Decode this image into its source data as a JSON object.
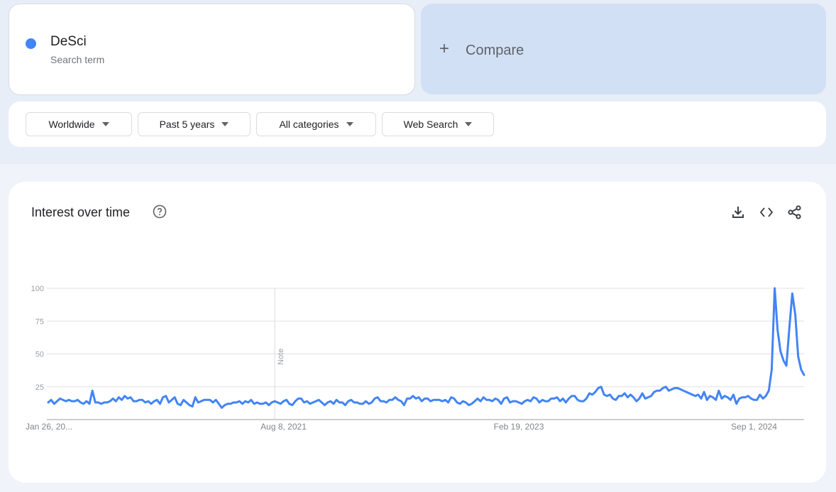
{
  "search_term": {
    "name": "DeSci",
    "subtitle": "Search term",
    "color": "#4285f4"
  },
  "compare": {
    "icon": "plus-icon",
    "label": "Compare"
  },
  "filters": [
    {
      "label": "Worldwide"
    },
    {
      "label": "Past 5 years"
    },
    {
      "label": "All categories"
    },
    {
      "label": "Web Search"
    }
  ],
  "interest_panel": {
    "title": "Interest over time",
    "icons": [
      "help-icon",
      "download-icon",
      "embed-code-icon",
      "share-icon"
    ]
  },
  "chart_data": {
    "type": "line",
    "title": "Interest over time",
    "xlabel": "",
    "ylabel": "",
    "ylim": [
      0,
      100
    ],
    "yticks": [
      25,
      50,
      75,
      100
    ],
    "x_tick_labels": [
      "Jan 26, 20...",
      "Aug 8, 2021",
      "Feb 19, 2023",
      "Sep 1, 2024"
    ],
    "x_tick_positions_index": [
      0,
      80,
      160,
      240
    ],
    "annotation": {
      "label": "Note",
      "index": 77
    },
    "grid": true,
    "legend": "none",
    "color": "#4285f4",
    "x_start": "Jan 26, 2020",
    "x_interval": "weekly",
    "series": [
      {
        "name": "DeSci",
        "values": [
          13,
          15,
          12,
          14,
          16,
          15,
          14,
          15,
          14,
          14,
          15,
          13,
          12,
          14,
          12,
          22,
          13,
          13,
          12,
          13,
          13,
          14,
          16,
          14,
          17,
          15,
          18,
          16,
          17,
          14,
          14,
          15,
          15,
          13,
          14,
          12,
          14,
          15,
          12,
          17,
          18,
          13,
          15,
          17,
          12,
          11,
          15,
          13,
          11,
          10,
          17,
          13,
          14,
          15,
          15,
          15,
          13,
          15,
          12,
          9,
          11,
          12,
          12,
          13,
          13,
          14,
          12,
          14,
          13,
          15,
          12,
          13,
          12,
          12,
          13,
          11,
          13,
          14,
          13,
          12,
          14,
          15,
          12,
          11,
          14,
          16,
          16,
          13,
          14,
          12,
          13,
          14,
          15,
          13,
          11,
          13,
          14,
          12,
          15,
          13,
          13,
          11,
          14,
          15,
          13,
          13,
          12,
          12,
          14,
          12,
          13,
          16,
          17,
          14,
          14,
          13,
          15,
          15,
          17,
          15,
          14,
          11,
          16,
          16,
          18,
          16,
          17,
          14,
          16,
          16,
          14,
          15,
          15,
          15,
          14,
          15,
          13,
          17,
          16,
          13,
          12,
          14,
          13,
          11,
          12,
          14,
          16,
          14,
          17,
          15,
          15,
          14,
          16,
          15,
          12,
          16,
          17,
          13,
          14,
          14,
          13,
          12,
          14,
          15,
          14,
          17,
          16,
          13,
          15,
          14,
          14,
          16,
          16,
          17,
          14,
          16,
          13,
          16,
          18,
          18,
          15,
          14,
          14,
          16,
          20,
          19,
          21,
          24,
          25,
          19,
          18,
          19,
          16,
          15,
          18,
          18,
          20,
          17,
          19,
          17,
          14,
          16,
          20,
          16,
          17,
          18,
          21,
          22,
          22,
          24,
          25,
          22,
          23,
          24,
          24,
          23,
          22,
          21,
          20,
          19,
          18,
          19,
          16,
          21,
          15,
          18,
          17,
          15,
          22,
          16,
          18,
          17,
          15,
          19,
          12,
          16,
          17,
          17,
          18,
          16,
          15,
          15,
          19,
          16,
          18,
          22,
          38,
          100,
          68,
          52,
          45,
          41,
          70,
          96,
          80,
          48,
          38,
          34
        ]
      }
    ]
  }
}
